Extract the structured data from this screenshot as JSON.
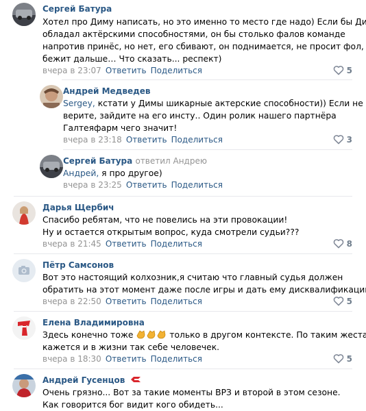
{
  "comments": [
    {
      "author": "Сергей Батура",
      "lines": [
        "Хотел про Диму написать, но это именно то место где надо) Если бы Дима",
        "обладал актёрскими способностями, он бы столько фалов команде",
        "напротив принёс, но нет, его сбивают, он поднимается, не просит фол,",
        "бежит дальше… Что сказать... респект)"
      ],
      "time": "вчера в 23:07",
      "reply": "Ответить",
      "share": "Поделиться",
      "likes": "5"
    },
    {
      "author": "Андрей Медведев",
      "mention": "Sergey,",
      "lines": [
        " кстати у Димы шикарные актерские способности)) Если не",
        "верите, зайдите на его инсту.. Один ролик нашего партнёра",
        "Галтеяфарм чего значит!"
      ],
      "time": "вчера в 23:18",
      "reply": "Ответить",
      "share": "Поделиться",
      "likes": "3"
    },
    {
      "author": "Сергей Батура",
      "replied_to": "ответил Андрею",
      "mention": "Андрей,",
      "lines": [
        " я про другое)"
      ],
      "time": "вчера в 23:25",
      "reply": "Ответить",
      "share": "Поделиться",
      "likes": ""
    },
    {
      "author": "Дарья Щербич",
      "lines": [
        "Спасибо ребятам, что не повелись на эти провокации!",
        "Ну и остается открытым вопрос, куда смотрели судьи???"
      ],
      "time": "вчера в 21:45",
      "reply": "Ответить",
      "share": "Поделиться",
      "likes": "8"
    },
    {
      "author": "Пётр Самсонов",
      "lines": [
        "Вот это настоящий колхозник,я считаю что главный судья должен",
        "обратить на этот момент даже после игры и дать ему дисквалификацию"
      ],
      "time": "вчера в 22:50",
      "reply": "Ответить",
      "share": "Поделиться",
      "likes": "5"
    },
    {
      "author": "Елена Владимировна",
      "lines": [
        "Здесь конечно тоже ",
        " только в другом контексте. По таким жестам",
        "кажется и в жизни так себе человечек."
      ],
      "time": "вчера в 18:30",
      "reply": "Ответить",
      "share": "Поделиться",
      "likes": "5"
    },
    {
      "author": "Андрей Гусенцов",
      "lines": [
        "Очень грязно... Вот за такие моменты ВРЗ и второй в этом сезоне.",
        "Как говорится бог видит кого обидеть..."
      ]
    }
  ],
  "icons": {
    "like": "heart-icon",
    "camera": "camera-icon",
    "clap": "clapping-hands-icon",
    "badge": "club-badge-icon"
  },
  "colors": {
    "link": "#2a5885",
    "meta": "#939393",
    "separator": "#e7e8ec",
    "like": "#6f7d8c"
  }
}
